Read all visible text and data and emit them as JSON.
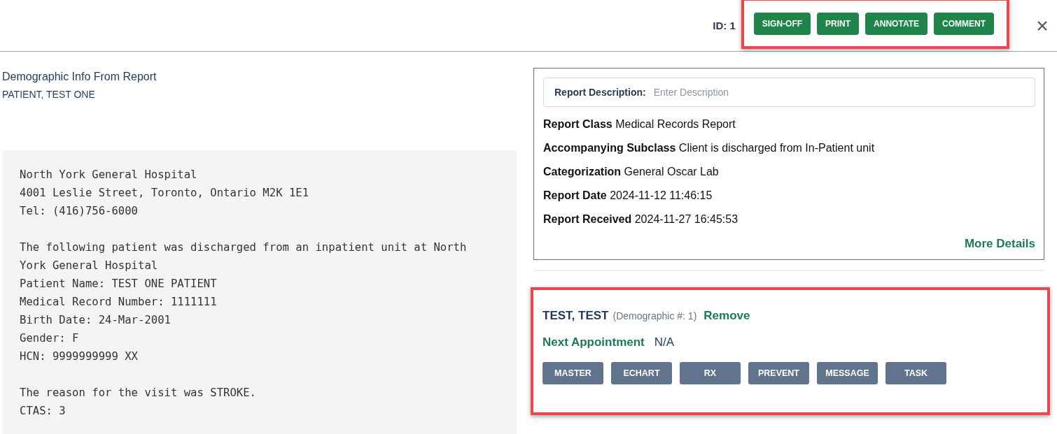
{
  "header": {
    "id_label": "ID: 1",
    "actions": [
      {
        "label": "SIGN-OFF"
      },
      {
        "label": "PRINT"
      },
      {
        "label": "ANNOTATE"
      },
      {
        "label": "COMMENT"
      }
    ],
    "highlighted": true
  },
  "demographic": {
    "heading": "Demographic Info From Report",
    "patient": "PATIENT, TEST ONE"
  },
  "report_text": [
    [
      "North York General Hospital",
      "4001 Leslie Street, Toronto, Ontario M2K 1E1",
      "Tel: (416)756-6000"
    ],
    [
      "The following patient was discharged from an inpatient unit at North",
      "York General Hospital",
      "Patient Name: TEST ONE PATIENT",
      "Medical Record Number: 1111111",
      "Birth Date: 24-Mar-2001",
      "Gender: F",
      "HCN: 9999999999 XX"
    ],
    [
      "The reason for the visit was STROKE.",
      "CTAS: 3"
    ]
  ],
  "details": {
    "description": {
      "label": "Report Description:",
      "placeholder": "Enter Description"
    },
    "fields": [
      {
        "label": "Report Class",
        "value": "Medical Records Report"
      },
      {
        "label": "Accompanying Subclass",
        "value": "Client is discharged from In-Patient unit"
      },
      {
        "label": "Categorization",
        "value": "General Oscar Lab"
      },
      {
        "label": "Report Date",
        "value": "2024-11-12 11:46:15"
      },
      {
        "label": "Report Received",
        "value": "2024-11-27 16:45:53"
      }
    ],
    "more_link": "More Details"
  },
  "linked_patient": {
    "highlighted": true,
    "name": "TEST, TEST",
    "demographic_no": "(Demographic #: 1)",
    "remove_link": "Remove",
    "next_appointment_label": "Next Appointment",
    "next_appointment": "N/A",
    "buttons": [
      {
        "label": "MASTER"
      },
      {
        "label": "ECHART"
      },
      {
        "label": "RX"
      },
      {
        "label": "PREVENT"
      },
      {
        "label": "MESSAGE"
      },
      {
        "label": "TASK"
      }
    ]
  }
}
